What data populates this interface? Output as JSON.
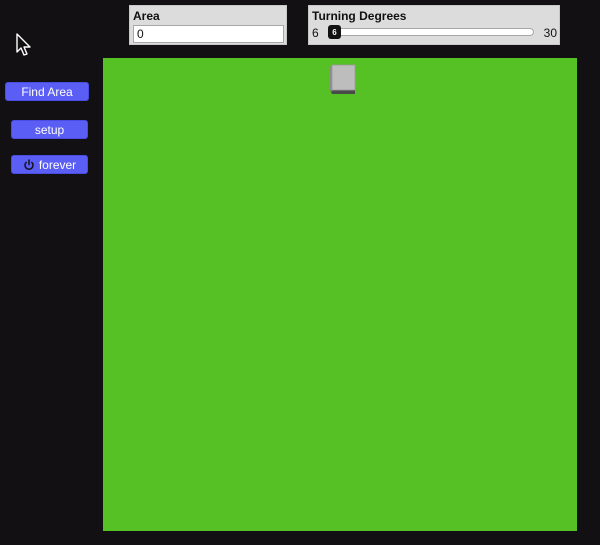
{
  "buttons": {
    "find_area": "Find Area",
    "setup": "setup",
    "forever": "forever"
  },
  "area_monitor": {
    "label": "Area",
    "value": "0"
  },
  "turning_slider": {
    "label": "Turning Degrees",
    "min": "6",
    "max": "30",
    "value": "6"
  },
  "icons": {
    "cursor": "cursor-icon",
    "forever": "forever-icon",
    "turtle": "turtle-box-icon"
  },
  "colors": {
    "background": "#121013",
    "button": "#5a5ef5",
    "world": "#56c125",
    "widget": "#dcdcdc"
  }
}
